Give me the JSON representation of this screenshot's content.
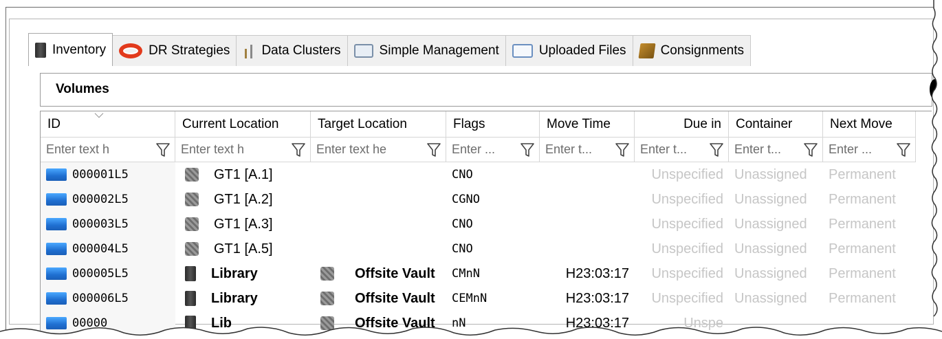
{
  "tabs": [
    {
      "label": "Inventory",
      "icon": "inventory-icon",
      "active": true
    },
    {
      "label": "DR Strategies",
      "icon": "lifebuoy-icon",
      "active": false
    },
    {
      "label": "Data Clusters",
      "icon": "clusters-icon",
      "active": false
    },
    {
      "label": "Simple Management",
      "icon": "window-icon",
      "active": false
    },
    {
      "label": "Uploaded Files",
      "icon": "document-icon",
      "active": false
    },
    {
      "label": "Consignments",
      "icon": "box-icon",
      "active": false
    }
  ],
  "section_title": "Volumes",
  "columns": [
    {
      "label": "ID",
      "placeholder": "Enter text h",
      "align": "left"
    },
    {
      "label": "Current Location",
      "placeholder": "Enter text h",
      "align": "left"
    },
    {
      "label": "Target Location",
      "placeholder": "Enter text he",
      "align": "left"
    },
    {
      "label": "Flags",
      "placeholder": "Enter ...",
      "align": "left"
    },
    {
      "label": "Move Time",
      "placeholder": "Enter t...",
      "align": "left"
    },
    {
      "label": "Due in",
      "placeholder": "Enter t...",
      "align": "right"
    },
    {
      "label": "Container",
      "placeholder": "Enter t...",
      "align": "left"
    },
    {
      "label": "Next Move",
      "placeholder": "Enter ...",
      "align": "left"
    }
  ],
  "rows": [
    {
      "id": "000001L5",
      "current": "GT1 [A.1]",
      "current_icon": "drive-icon",
      "current_bold": false,
      "target": "",
      "target_icon": "",
      "flags": "CNO",
      "move_time": "",
      "due_in": "Unspecified",
      "container": "Unassigned",
      "next_move": "Permanent"
    },
    {
      "id": "000002L5",
      "current": "GT1 [A.2]",
      "current_icon": "drive-icon",
      "current_bold": false,
      "target": "",
      "target_icon": "",
      "flags": "CGNO",
      "move_time": "",
      "due_in": "Unspecified",
      "container": "Unassigned",
      "next_move": "Permanent"
    },
    {
      "id": "000003L5",
      "current": "GT1 [A.3]",
      "current_icon": "drive-icon",
      "current_bold": false,
      "target": "",
      "target_icon": "",
      "flags": "CNO",
      "move_time": "",
      "due_in": "Unspecified",
      "container": "Unassigned",
      "next_move": "Permanent"
    },
    {
      "id": "000004L5",
      "current": "GT1 [A.5]",
      "current_icon": "drive-icon",
      "current_bold": false,
      "target": "",
      "target_icon": "",
      "flags": "CNO",
      "move_time": "",
      "due_in": "Unspecified",
      "container": "Unassigned",
      "next_move": "Permanent"
    },
    {
      "id": "000005L5",
      "current": "Library",
      "current_icon": "library-icon",
      "current_bold": true,
      "target": "Offsite Vault",
      "target_icon": "drive-icon",
      "flags": "CMnN",
      "move_time": "H23:03:17",
      "due_in": "Unspecified",
      "container": "Unassigned",
      "next_move": "Permanent"
    },
    {
      "id": "000006L5",
      "current": "Library",
      "current_icon": "library-icon",
      "current_bold": true,
      "target": "Offsite Vault",
      "target_icon": "drive-icon",
      "flags": "CEMnN",
      "move_time": "H23:03:17",
      "due_in": "Unspecified",
      "container": "Unassigned",
      "next_move": "Permanent"
    },
    {
      "id": "00000",
      "current": "Lib",
      "current_icon": "library-icon",
      "current_bold": true,
      "target": "Offsite Vault",
      "target_icon": "drive-icon",
      "flags": "nN",
      "move_time": "H23:03:17",
      "due_in": "Unspe",
      "container": "",
      "next_move": ""
    }
  ],
  "colors": {
    "volume_icon": "#1f6fd1",
    "muted_text": "#c6c6c6",
    "dr_icon": "#e23a1c"
  }
}
